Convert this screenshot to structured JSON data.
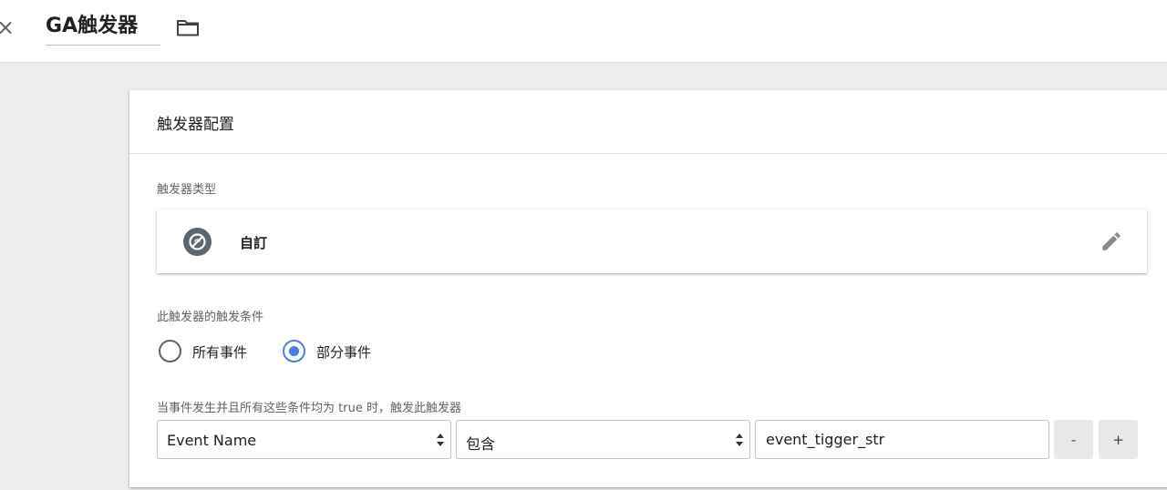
{
  "header": {
    "close_icon": "×",
    "title": "GA触发器",
    "folder_icon": "folder-icon"
  },
  "panel": {
    "title": "触发器配置",
    "trigger_type": {
      "section_label": "触发器类型",
      "type_name": "自訂",
      "type_icon": "custom-event-icon",
      "edit_icon": "pencil-icon",
      "icon_color": "#5b6770"
    },
    "fire_condition": {
      "section_label": "此触发器的触发条件",
      "options": [
        {
          "label": "所有事件",
          "selected": false
        },
        {
          "label": "部分事件",
          "selected": true
        }
      ],
      "accent_color": "#4b7bec"
    },
    "conditions": {
      "section_label": "当事件发生并且所有这些条件均为 true 时，触发此触发器",
      "rows": [
        {
          "variable": "Event Name",
          "operator": "包含",
          "value": "event_tigger_str",
          "remove_label": "-",
          "add_label": "+"
        }
      ]
    }
  }
}
